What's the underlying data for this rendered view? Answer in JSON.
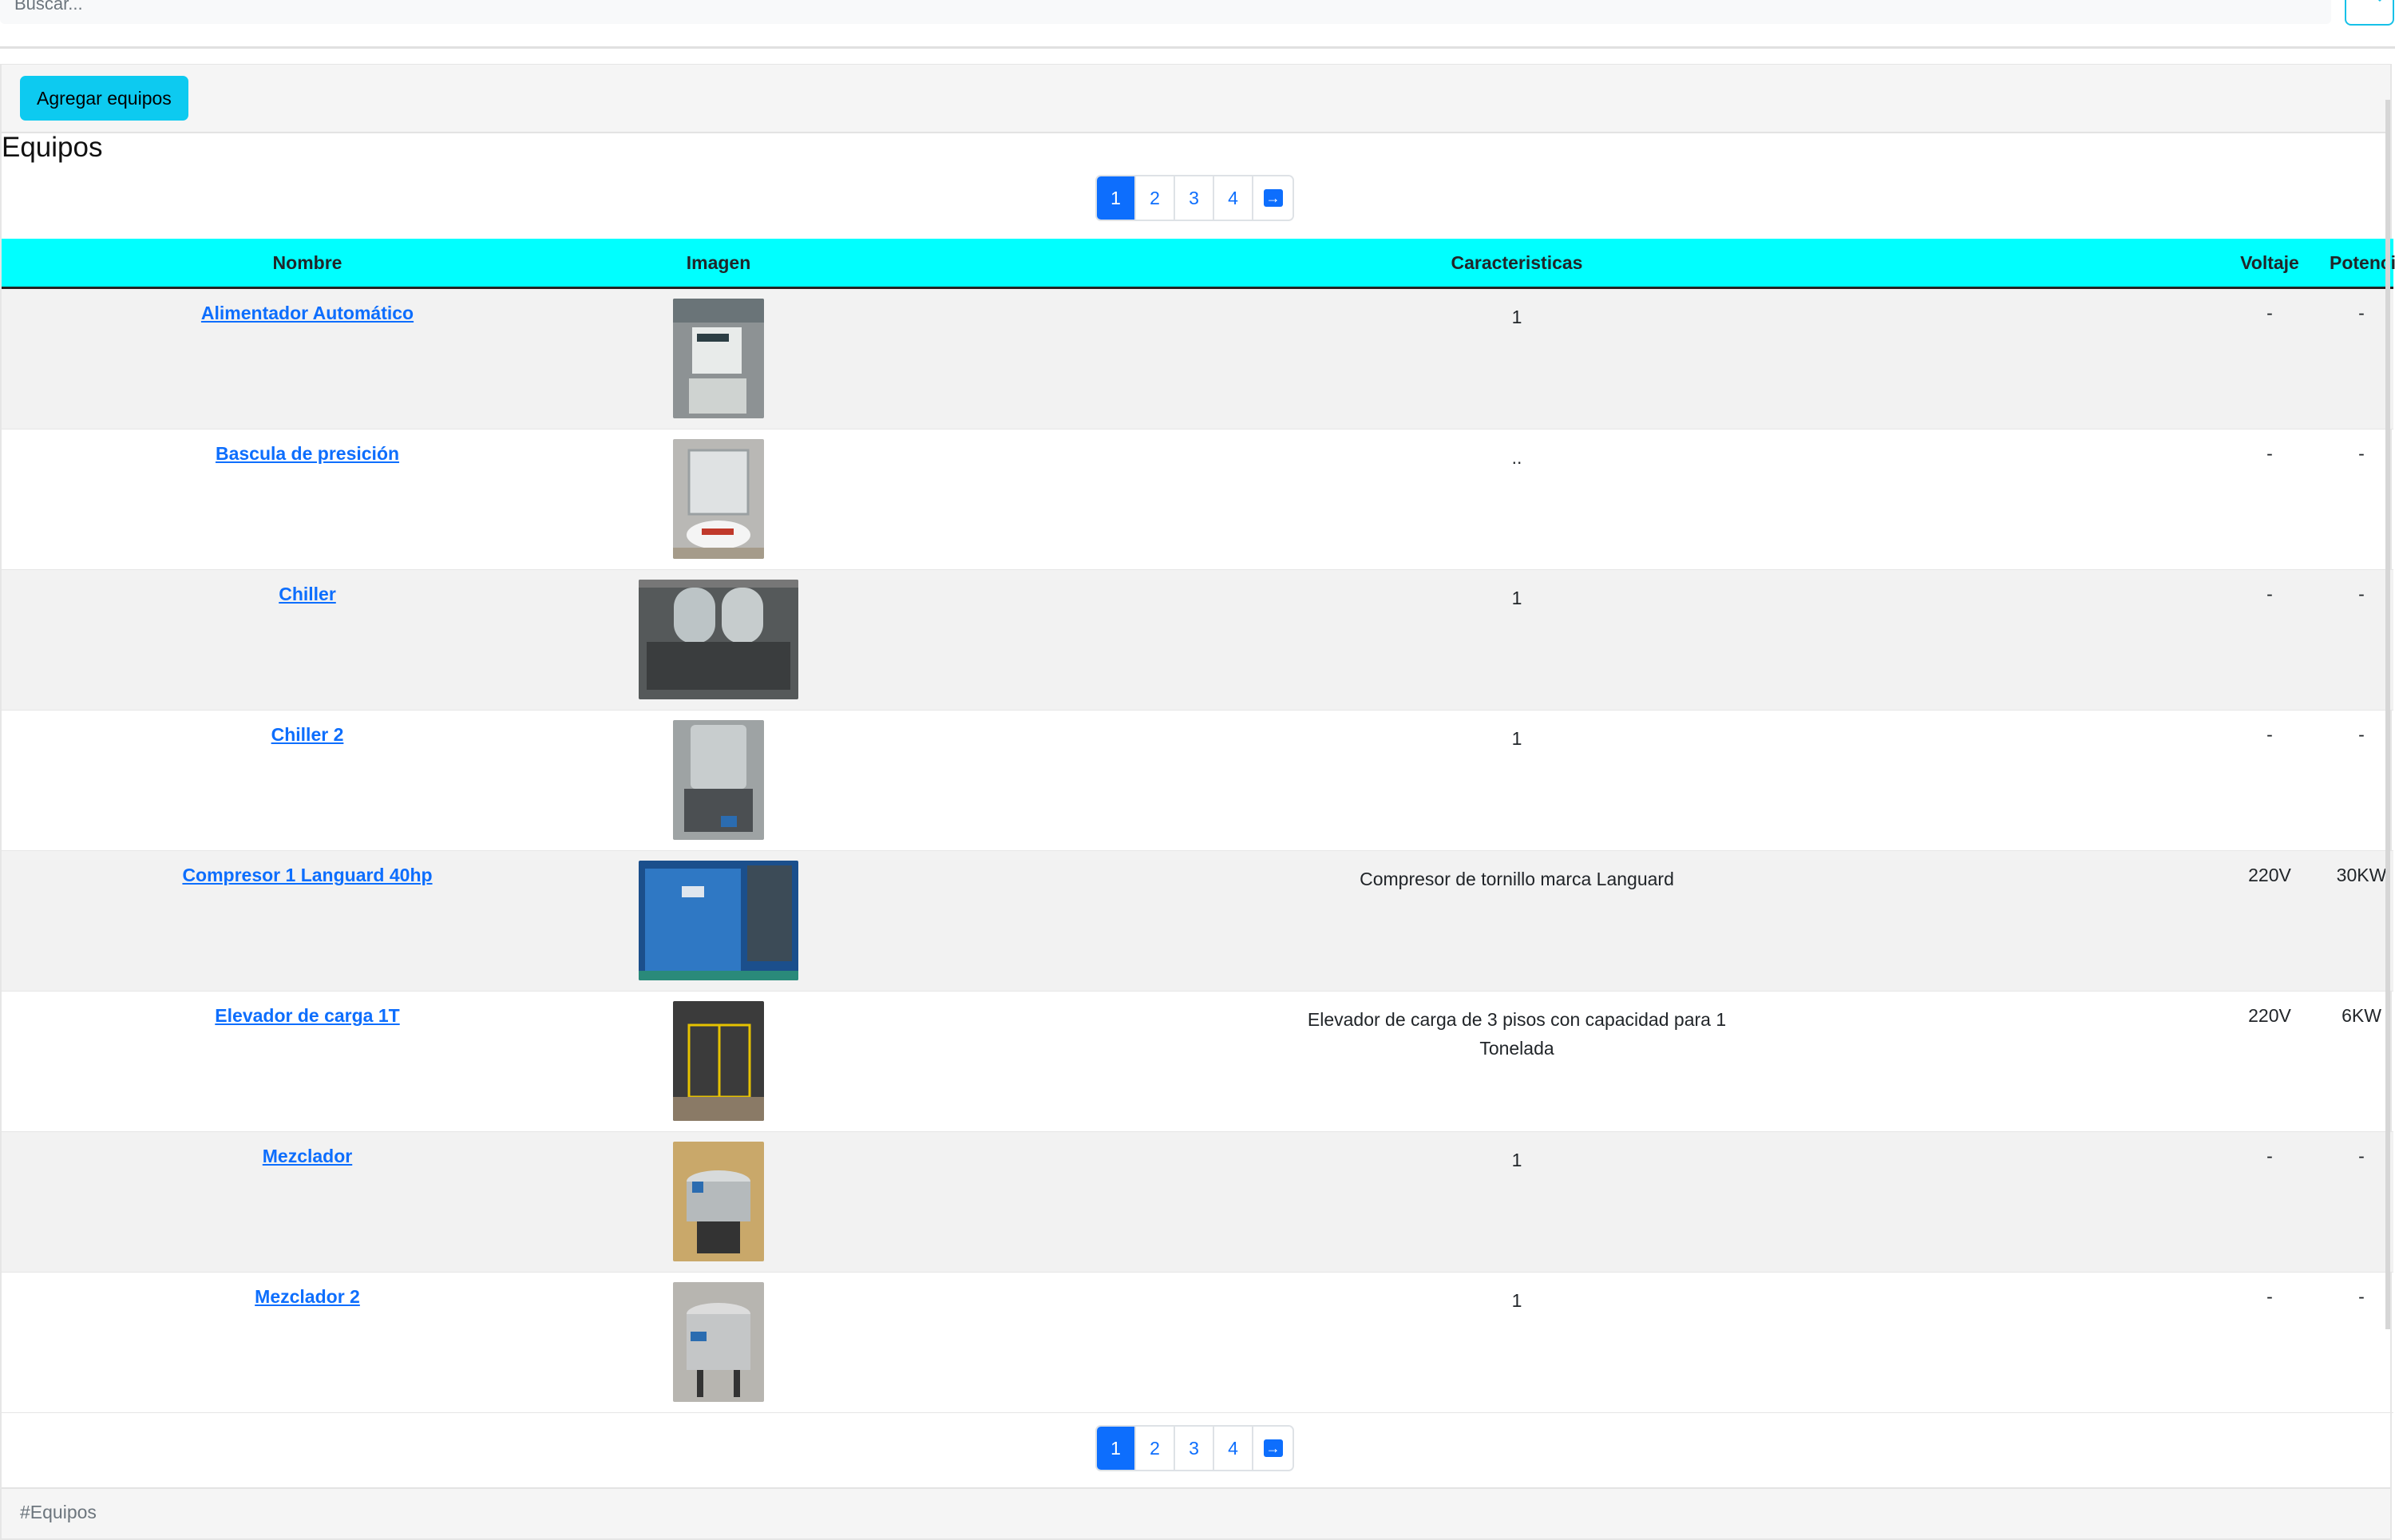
{
  "search": {
    "placeholder": "Buscar..."
  },
  "toolbar": {
    "add_label": "Agregar equipos"
  },
  "page": {
    "title": "Equipos"
  },
  "pagination": {
    "pages": [
      "1",
      "2",
      "3",
      "4"
    ],
    "next_icon": "arrow-right-icon",
    "active": "1"
  },
  "table": {
    "headers": [
      "Nombre",
      "Imagen",
      "Caracteristicas",
      "Voltaje",
      "Potencia"
    ],
    "rows": [
      {
        "name": "Alimentador Automático",
        "image": "alimentador-photo",
        "chars": "1",
        "voltage": "-",
        "power": "-"
      },
      {
        "name": "Bascula de presición",
        "image": "bascula-photo",
        "chars": "..",
        "voltage": "-",
        "power": "-"
      },
      {
        "name": "Chiller",
        "image": "chiller-photo",
        "chars": "1",
        "voltage": "-",
        "power": "-"
      },
      {
        "name": "Chiller 2",
        "image": "chiller-2-photo",
        "chars": "1",
        "voltage": "-",
        "power": "-"
      },
      {
        "name": "Compresor 1 Languard 40hp",
        "image": "compresor-photo",
        "chars": "Compresor de tornillo marca Languard",
        "voltage": "220V",
        "power": "30KW"
      },
      {
        "name": "Elevador de carga 1T",
        "image": "elevador-photo",
        "chars": "Elevador de carga de 3 pisos con capacidad para 1 Tonelada",
        "voltage": "220V",
        "power": "6KW"
      },
      {
        "name": "Mezclador",
        "image": "mezclador-photo",
        "chars": "1",
        "voltage": "-",
        "power": "-"
      },
      {
        "name": "Mezclador 2",
        "image": "mezclador-2-photo",
        "chars": "1",
        "voltage": "-",
        "power": "-"
      }
    ]
  },
  "footer": {
    "text": "#Equipos"
  },
  "colors": {
    "accent": "#0dcaf0",
    "header_bg": "#00ffff",
    "link": "#0d6efd"
  }
}
